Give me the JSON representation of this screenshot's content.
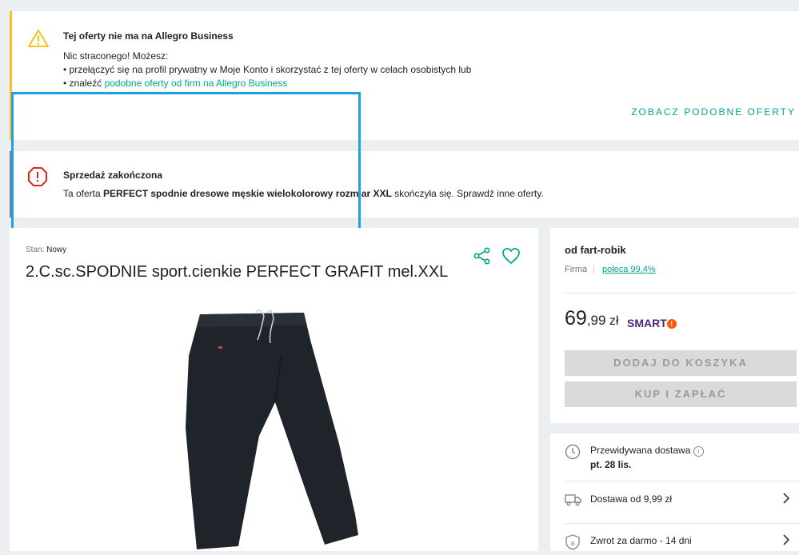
{
  "business_notice": {
    "title": "Tej oferty nie ma na Allegro Business",
    "intro": "Nic straconego! Możesz:",
    "bullet1": "• przełączyć się na profil prywatny w Moje Konto i skorzystać z tej oferty w celach osobistych lub",
    "bullet2_prefix": "• znaleźć ",
    "bullet2_link": "podobne oferty od firm na Allegro Business",
    "action_label": "ZOBACZ PODOBNE OFERTY",
    "accent_color": "#f6c31e",
    "icon": "warning-icon"
  },
  "ended_notice": {
    "title": "Sprzedaż zakończona",
    "body_prefix": "Ta oferta ",
    "body_bold": "PERFECT spodnie dresowe męskie wielokolorowy rozmiar XXL",
    "body_suffix": " skończyła się. Sprawdź inne oferty.",
    "icon": "error-icon",
    "icon_color": "#e2231a"
  },
  "product": {
    "condition_label": "Stan:",
    "condition_value": "Nowy",
    "title": "2.C.sc.SPODNIE sport.cienkie PERFECT GRAFIT mel.XXL",
    "image_alt": "dark sweatpants photo"
  },
  "seller": {
    "name": "od fart-robik",
    "type": "Firma",
    "separator": "|",
    "rating": "poleca 99,4%"
  },
  "price": {
    "integer": "69",
    "decimal": ",99",
    "currency": "zł",
    "smart_label": "SMART"
  },
  "buttons": {
    "add_to_cart": "DODAJ DO KOSZYKA",
    "buy_now": "KUP I ZAPŁAĆ"
  },
  "delivery": {
    "expected_label": "Przewidywana dostawa",
    "expected_date": "pt. 28 lis.",
    "shipping": "Dostawa od 9,99 zł",
    "returns": "Zwrot za darmo - 14 dni"
  },
  "colors": {
    "accent": "#00a790",
    "highlight": "#1aa3e0",
    "smart": "#4a2a78"
  }
}
